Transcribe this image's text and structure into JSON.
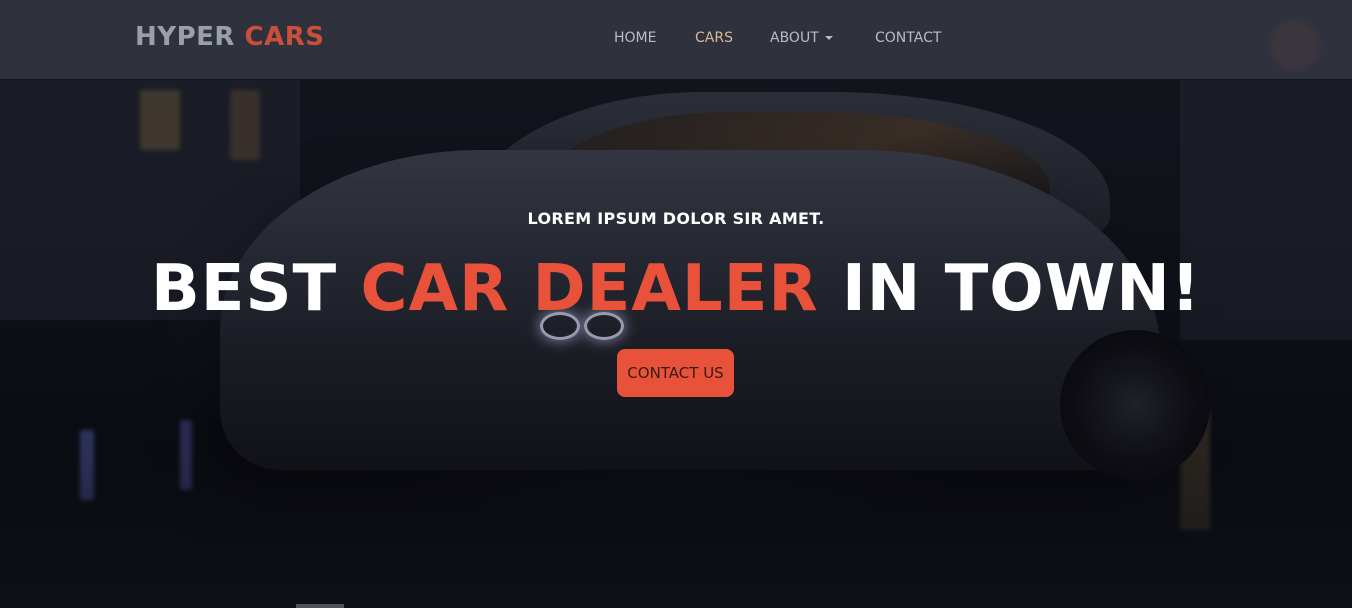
{
  "brand": {
    "part1": "HYPER",
    "part2": "CARS"
  },
  "nav": {
    "items": [
      {
        "label": "HOME"
      },
      {
        "label": "CARS"
      },
      {
        "label": "ABOUT"
      },
      {
        "label": "CONTACT"
      }
    ],
    "active": "CARS"
  },
  "hero": {
    "subtitle": "LOREM IPSUM DOLOR SIR AMET.",
    "headline_start": "BEST",
    "headline_accent": "CAR DEALER",
    "headline_end": "IN TOWN!",
    "cta_label": "CONTACT US"
  },
  "colors": {
    "accent": "#e8523a",
    "nav_bg": "#3a3e48",
    "brand_gray": "#9aa0aa"
  },
  "icons": {
    "about_dropdown": "caret-down-icon"
  }
}
